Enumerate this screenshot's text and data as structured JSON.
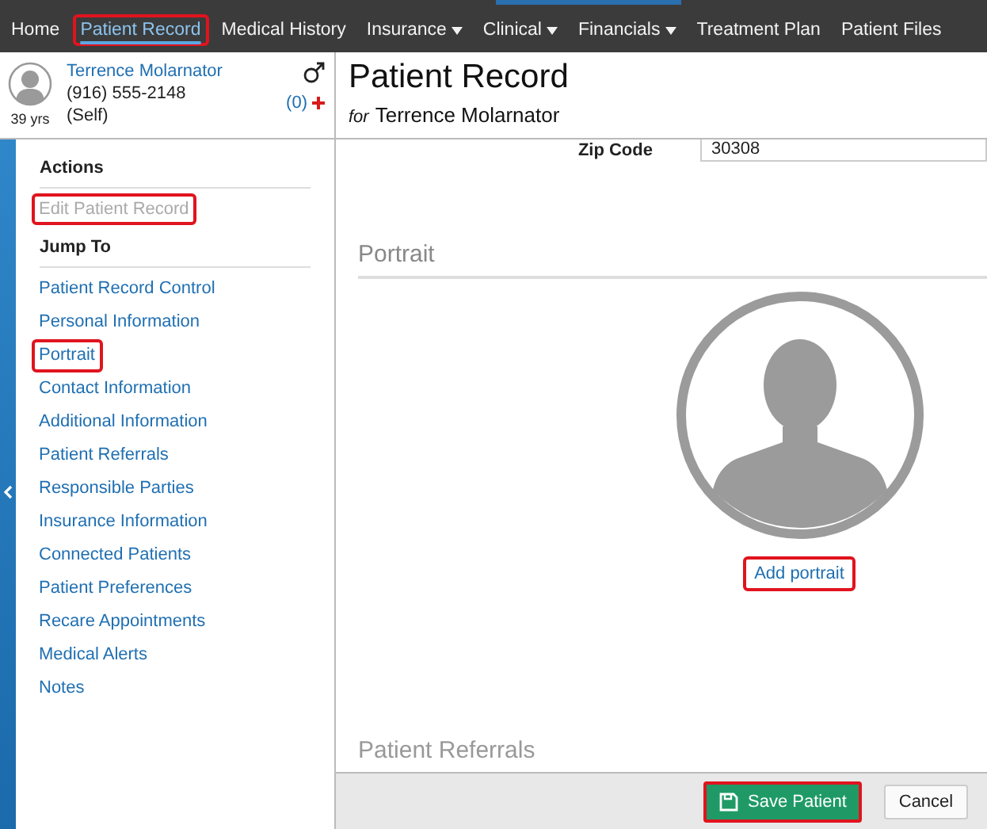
{
  "nav": [
    {
      "label": "Home",
      "selected": false,
      "dropdown": false,
      "annotated": false
    },
    {
      "label": "Patient Record",
      "selected": true,
      "dropdown": false,
      "annotated": true
    },
    {
      "label": "Medical History",
      "selected": false,
      "dropdown": false,
      "annotated": false
    },
    {
      "label": "Insurance",
      "selected": false,
      "dropdown": true,
      "annotated": false
    },
    {
      "label": "Clinical",
      "selected": false,
      "dropdown": true,
      "annotated": false
    },
    {
      "label": "Financials",
      "selected": false,
      "dropdown": true,
      "annotated": false
    },
    {
      "label": "Treatment Plan",
      "selected": false,
      "dropdown": false,
      "annotated": false
    },
    {
      "label": "Patient Files",
      "selected": false,
      "dropdown": false,
      "annotated": false
    }
  ],
  "patient": {
    "name": "Terrence Molarnator",
    "phone": "(916) 555-2148",
    "relation": "(Self)",
    "age": "39 yrs",
    "alerts": "(0)"
  },
  "header": {
    "title": "Patient Record",
    "for_label": "for",
    "patient_name": "Terrence Molarnator"
  },
  "sidebar": {
    "actions_heading": "Actions",
    "actions": [
      {
        "label": "Edit Patient Record",
        "disabled": true,
        "annotated": true
      }
    ],
    "jump_heading": "Jump To",
    "links": [
      {
        "label": "Patient Record Control",
        "annotated": false
      },
      {
        "label": "Personal Information",
        "annotated": false
      },
      {
        "label": "Portrait",
        "annotated": true
      },
      {
        "label": "Contact Information",
        "annotated": false
      },
      {
        "label": "Additional Information",
        "annotated": false
      },
      {
        "label": "Patient Referrals",
        "annotated": false
      },
      {
        "label": "Responsible Parties",
        "annotated": false
      },
      {
        "label": "Insurance Information",
        "annotated": false
      },
      {
        "label": "Connected Patients",
        "annotated": false
      },
      {
        "label": "Patient Preferences",
        "annotated": false
      },
      {
        "label": "Recare Appointments",
        "annotated": false
      },
      {
        "label": "Medical Alerts",
        "annotated": false
      },
      {
        "label": "Notes",
        "annotated": false
      }
    ]
  },
  "form": {
    "fields": [
      {
        "label": "Zip Code",
        "value": "30308"
      }
    ],
    "portrait_heading": "Portrait",
    "portrait_link": {
      "label": "Add portrait",
      "annotated": true
    },
    "next_heading": "Patient Referrals"
  },
  "footer": {
    "buttons": [
      {
        "label": "Save Patient",
        "kind": "primary",
        "annotated": true
      },
      {
        "label": "Cancel",
        "kind": "secondary",
        "annotated": false
      }
    ]
  }
}
